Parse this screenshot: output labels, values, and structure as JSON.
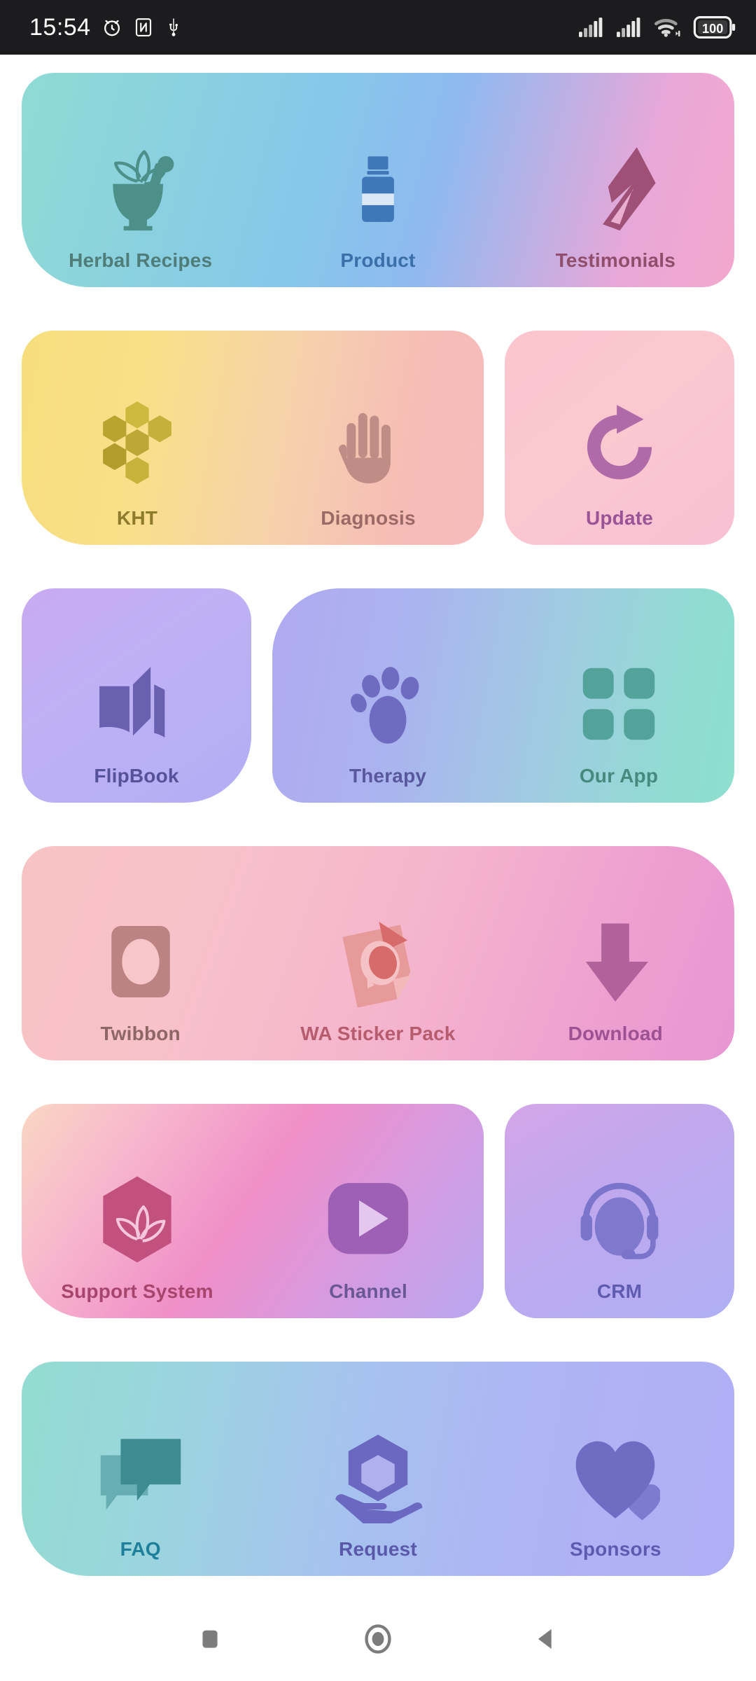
{
  "status_bar": {
    "time": "15:54",
    "left_icons": [
      "alarm-icon",
      "nfc-icon",
      "usb-icon"
    ],
    "right_icons": [
      "signal-sim1-icon",
      "signal-sim2-icon",
      "wifi-icon",
      "battery-icon"
    ],
    "battery_level": "100"
  },
  "menu": {
    "rows": [
      {
        "cards": [
          {
            "name": "card-row1",
            "width": "full",
            "radius": "rad-a",
            "gradient": "linear-gradient(105deg,#8fdbd4 0%,#86c7ea 42%,#8fb9f0 58%,#e9a7d8 85%,#f3a8cd 100%)",
            "tiles": [
              {
                "label": "Herbal Recipes",
                "icon": "mortar-pestle-icon",
                "color": "#4d8f89",
                "text_color": "#4e7d7a"
              },
              {
                "label": "Product",
                "icon": "bottle-icon",
                "color": "#3f78b8",
                "text_color": "#3b6fa8"
              },
              {
                "label": "Testimonials",
                "icon": "quill-pen-icon",
                "color": "#9e5076",
                "text_color": "#8f4e6c"
              }
            ]
          }
        ]
      },
      {
        "cards": [
          {
            "name": "card-row2-left",
            "width": "wide",
            "radius": "rad-a",
            "gradient": "linear-gradient(100deg,#f7dd7c 0%,#f8e08a 28%,#f6cfae 60%,#f6bcb6 82%,#f7bbbd 100%)",
            "tiles": [
              {
                "label": "KHT",
                "icon": "honeycomb-icon",
                "color": "#b3a034",
                "text_color": "#8d7a2a"
              },
              {
                "label": "Diagnosis",
                "icon": "hand-icon",
                "color": "#c08c86",
                "text_color": "#9c6a66"
              }
            ]
          },
          {
            "name": "card-row2-right",
            "width": "narrow",
            "radius": "rad-e",
            "gradient": "linear-gradient(140deg,#fbc5ce 0%,#fbc8d0 45%,#f8c0d4 100%)",
            "tiles": [
              {
                "label": "Update",
                "icon": "refresh-icon",
                "color": "#b06aa8",
                "text_color": "#9a5495"
              }
            ]
          }
        ]
      },
      {
        "cards": [
          {
            "name": "card-row3-left",
            "width": "narrow-left",
            "radius": "rad-d",
            "gradient": "linear-gradient(145deg,#c9aaf2 0%,#bfb0f4 40%,#b3aef4 100%)",
            "tiles": [
              {
                "label": "FlipBook",
                "icon": "open-book-icon",
                "color": "#6a60b0",
                "text_color": "#56519b"
              }
            ]
          },
          {
            "name": "card-row3-right",
            "width": "wide-right",
            "radius": "rad-c",
            "gradient": "linear-gradient(100deg,#b0a9f1 0%,#aab4ef 30%,#9ecfdf 65%,#8fdcd0 88%,#8ee0cf 100%)",
            "tiles": [
              {
                "label": "Therapy",
                "icon": "paw-print-icon",
                "color": "#6d6cc0",
                "text_color": "#59589f"
              },
              {
                "label": "Our App",
                "icon": "grid-squares-icon",
                "color": "#54a39b",
                "text_color": "#46897f"
              }
            ]
          }
        ]
      },
      {
        "cards": [
          {
            "name": "card-row4",
            "width": "full",
            "radius": "rad-b",
            "gradient": "linear-gradient(110deg,#f8c3c3 0%,#f7c2c9 25%,#f5b4cd 55%,#ed9fd0 82%,#e896d2 100%)",
            "tiles": [
              {
                "label": "Twibbon",
                "icon": "frame-portrait-icon",
                "color": "#bb8483",
                "text_color": "#8e6765"
              },
              {
                "label": "WA Sticker Pack",
                "icon": "sticker-chat-icon",
                "color": "#d76b6b",
                "text_color": "#b55d6e"
              },
              {
                "label": "Download",
                "icon": "download-arrow-icon",
                "color": "#b2629b",
                "text_color": "#9c5292"
              }
            ]
          }
        ]
      },
      {
        "cards": [
          {
            "name": "card-row5-left",
            "width": "wide",
            "radius": "rad-a",
            "gradient": "linear-gradient(125deg,#fad7c2 0%,#f7b7cd 22%,#f08fc8 48%,#d79ae0 72%,#b8a7f0 100%)",
            "tiles": [
              {
                "label": "Support System",
                "icon": "hexagon-leaves-icon",
                "color": "#c3517f",
                "text_color": "#a8456f"
              },
              {
                "label": "Channel",
                "icon": "youtube-play-icon",
                "color": "#9d60b4",
                "text_color": "#6a5894"
              }
            ]
          },
          {
            "name": "card-row5-right",
            "width": "narrow",
            "radius": "rad-e",
            "gradient": "linear-gradient(150deg,#d4a5e8 0%,#c0a8ee 40%,#afaff4 100%)",
            "tiles": [
              {
                "label": "CRM",
                "icon": "headset-icon",
                "color": "#7a75cb",
                "text_color": "#5f5cb0"
              }
            ]
          }
        ]
      },
      {
        "cards": [
          {
            "name": "card-row6",
            "width": "full",
            "radius": "rad-a",
            "gradient": "linear-gradient(100deg,#93dcd0 0%,#9ad5de 20%,#a6c3ee 45%,#aeb4f4 70%,#b0aef5 100%)",
            "tiles": [
              {
                "label": "FAQ",
                "icon": "chat-bubbles-icon",
                "color": "#3e8c91",
                "text_color": "#1e7f9a"
              },
              {
                "label": "Request",
                "icon": "hand-hexagon-icon",
                "color": "#6a68c0",
                "text_color": "#5a58a8"
              },
              {
                "label": "Sponsors",
                "icon": "hearts-icon",
                "color": "#6f6cc4",
                "text_color": "#5d5ab0"
              }
            ]
          }
        ]
      }
    ]
  },
  "nav_bar": {
    "buttons": [
      {
        "name": "recents-button",
        "icon": "square-icon"
      },
      {
        "name": "home-button",
        "icon": "circle-icon"
      },
      {
        "name": "back-button",
        "icon": "triangle-left-icon"
      }
    ]
  }
}
